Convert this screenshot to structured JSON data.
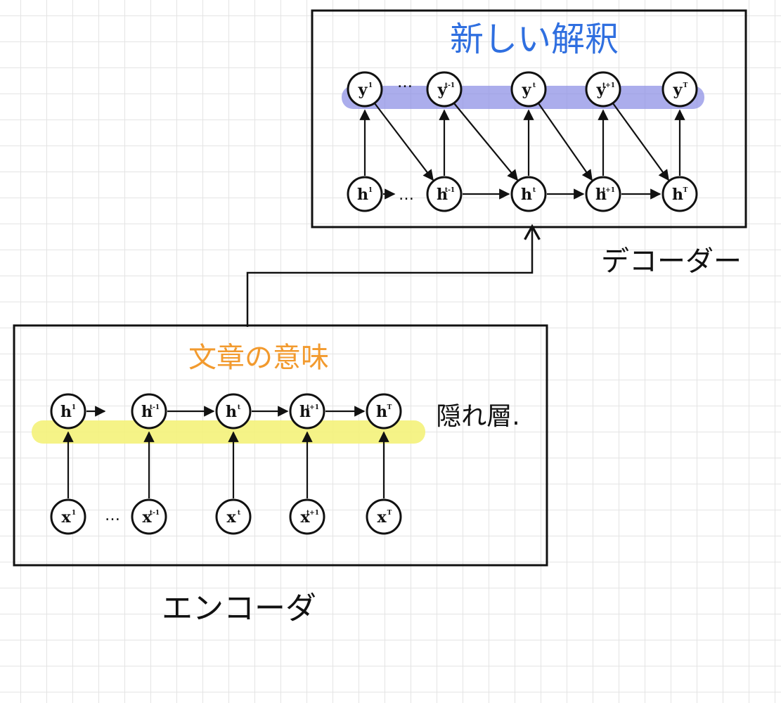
{
  "decoder": {
    "title": "新しい解釈",
    "label": "デコーダー",
    "highlight_color": "#8f92e6",
    "title_color": "#2f6fe0",
    "y_nodes": [
      {
        "base": "y",
        "sup": "1"
      },
      {
        "base": "y",
        "sup": "t-1"
      },
      {
        "base": "y",
        "sup": "t"
      },
      {
        "base": "y",
        "sup": "t+1"
      },
      {
        "base": "y",
        "sup": "T"
      }
    ],
    "h_nodes": [
      {
        "base": "h",
        "sup": "1"
      },
      {
        "base": "h",
        "sup": "t-1"
      },
      {
        "base": "h",
        "sup": "t"
      },
      {
        "base": "h",
        "sup": "t+1"
      },
      {
        "base": "h",
        "sup": "T"
      }
    ],
    "ellipsis_top": "…",
    "ellipsis_bottom": "…"
  },
  "encoder": {
    "title": "文章の意味",
    "label": "エンコーダ",
    "hidden_label": "隠れ層.",
    "highlight_color": "#f4f27a",
    "title_color": "#f29a2e",
    "h_nodes": [
      {
        "base": "h",
        "sup": "1"
      },
      {
        "base": "h",
        "sup": "t-1"
      },
      {
        "base": "h",
        "sup": "t"
      },
      {
        "base": "h",
        "sup": "t+1"
      },
      {
        "base": "h",
        "sup": "T"
      }
    ],
    "x_nodes": [
      {
        "base": "x",
        "sup": "1"
      },
      {
        "base": "x",
        "sup": "t-1"
      },
      {
        "base": "x",
        "sup": "t"
      },
      {
        "base": "x",
        "sup": "t+1"
      },
      {
        "base": "x",
        "sup": "T"
      }
    ],
    "ellipsis": "…"
  }
}
